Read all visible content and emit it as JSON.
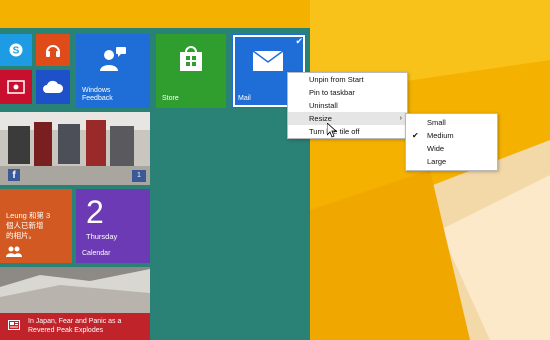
{
  "tiles": {
    "windows_feedback": "Windows\nFeedback",
    "store": "Store",
    "mail": "Mail",
    "facebook_badge": "1",
    "people_text": "Leung 和第 3\n個人已新增\n的相片。",
    "calendar_day": "2",
    "calendar_weekday": "Thursday",
    "calendar_label": "Calendar",
    "news_headline": "In Japan, Fear and Panic as a Revered Peak Explodes"
  },
  "context_menu": {
    "items": [
      "Unpin from Start",
      "Pin to taskbar",
      "Uninstall",
      "Resize",
      "Turn live tile off"
    ],
    "resize_arrow": "›"
  },
  "resize_menu": {
    "items": [
      "Small",
      "Medium",
      "Wide",
      "Large"
    ],
    "selected": "Medium",
    "check": "✔"
  },
  "colors": {
    "start_background": "#2a8176",
    "wallpaper": "#f5b100",
    "tile_blue": "#1f6ed8",
    "tile_green": "#2f9e2f",
    "tile_purple": "#6d3ab5",
    "tile_orange": "#d25a22",
    "tile_red": "#c0232a"
  }
}
